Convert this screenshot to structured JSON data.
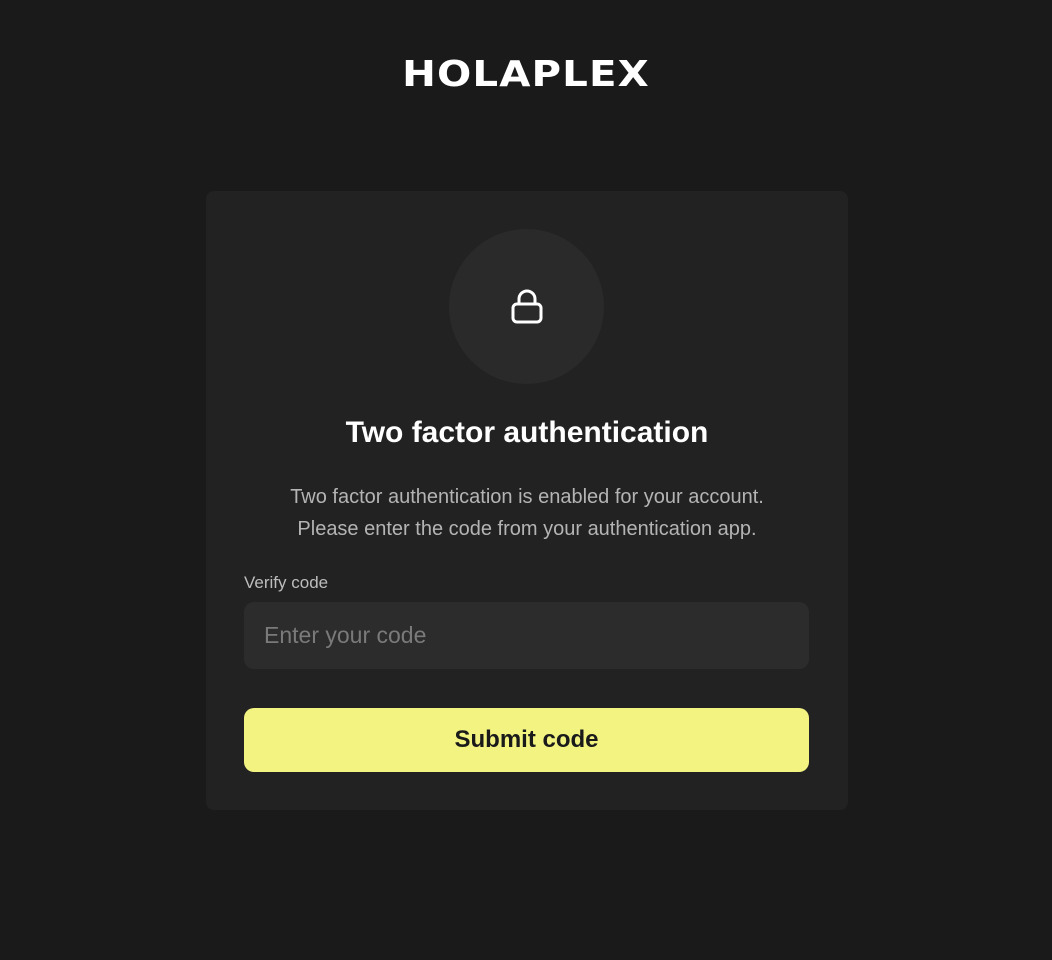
{
  "brand": {
    "logo_text": "HOLAPLEX"
  },
  "card": {
    "icon": "lock-icon",
    "title": "Two factor authentication",
    "description_line1": "Two factor authentication is enabled for your account.",
    "description_line2": "Please enter the code from your authentication app.",
    "field_label": "Verify code",
    "input_value": "",
    "input_placeholder": "Enter your code",
    "submit_label": "Submit code"
  },
  "colors": {
    "background": "#1a1a1b",
    "card": "#222223",
    "accent_button": "#f3f382",
    "input_background": "#2c2c2d"
  }
}
